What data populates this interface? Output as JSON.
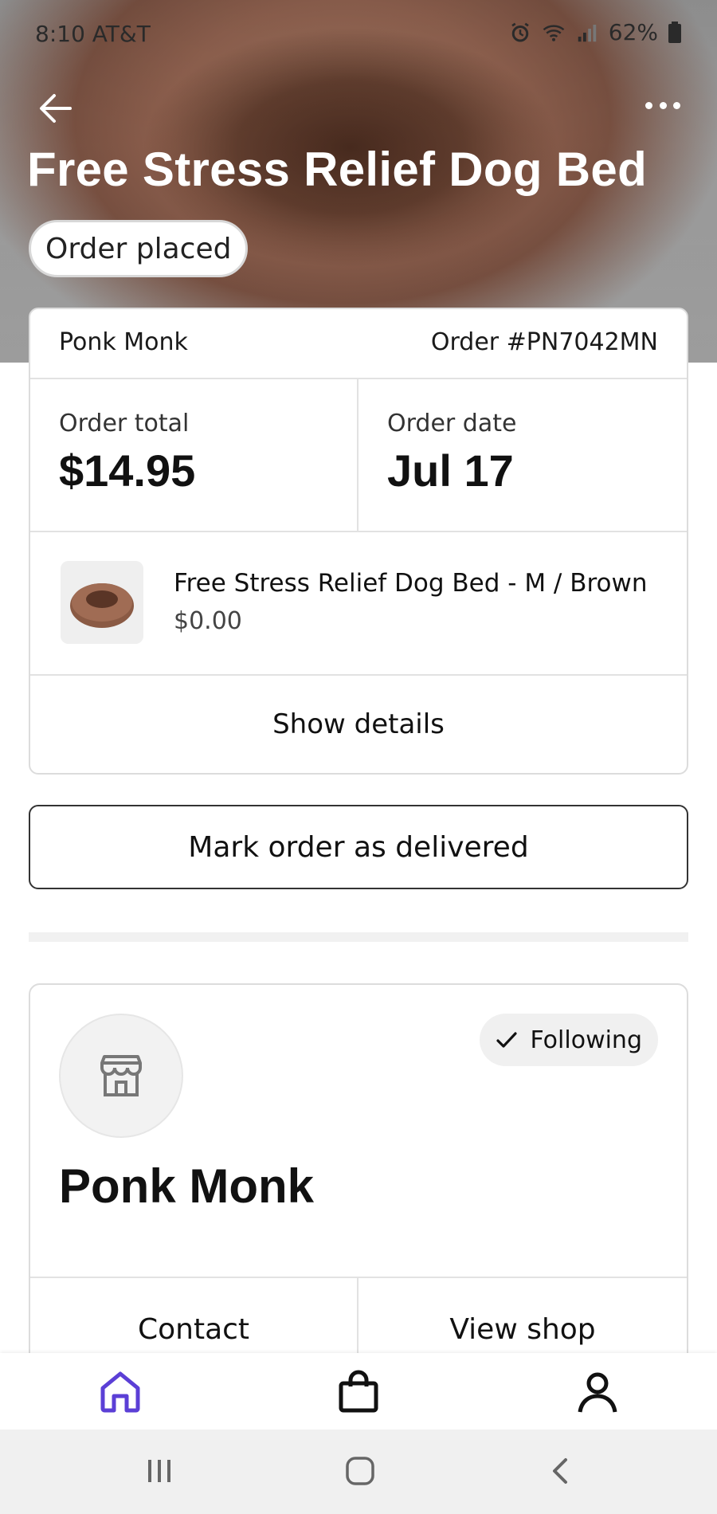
{
  "status_bar": {
    "time_carrier": "8:10 AT&T",
    "battery": "62%"
  },
  "header": {
    "title": "Free Stress Relief Dog Bed",
    "status_pill": "Order placed"
  },
  "order_card": {
    "shop_name": "Ponk Monk",
    "order_number": "Order #PN7042MN",
    "total_label": "Order total",
    "total_value": "$14.95",
    "date_label": "Order date",
    "date_value": "Jul 17",
    "item": {
      "name": "Free Stress Relief Dog Bed - M / Brown",
      "price": "$0.00"
    },
    "details_label": "Show details"
  },
  "mark_delivered_label": "Mark order as delivered",
  "shop_card": {
    "follow_label": "Following",
    "shop_name": "Ponk Monk",
    "contact_label": "Contact",
    "view_shop_label": "View shop"
  },
  "colors": {
    "accent": "#5b3fd6",
    "text": "#111111",
    "border": "#dcdcdc"
  },
  "icons": {
    "back": "arrow-left-icon",
    "more": "more-horizontal-icon",
    "store": "store-icon",
    "check": "check-icon",
    "home": "home-icon",
    "bag": "shopping-bag-icon",
    "profile": "profile-icon"
  }
}
